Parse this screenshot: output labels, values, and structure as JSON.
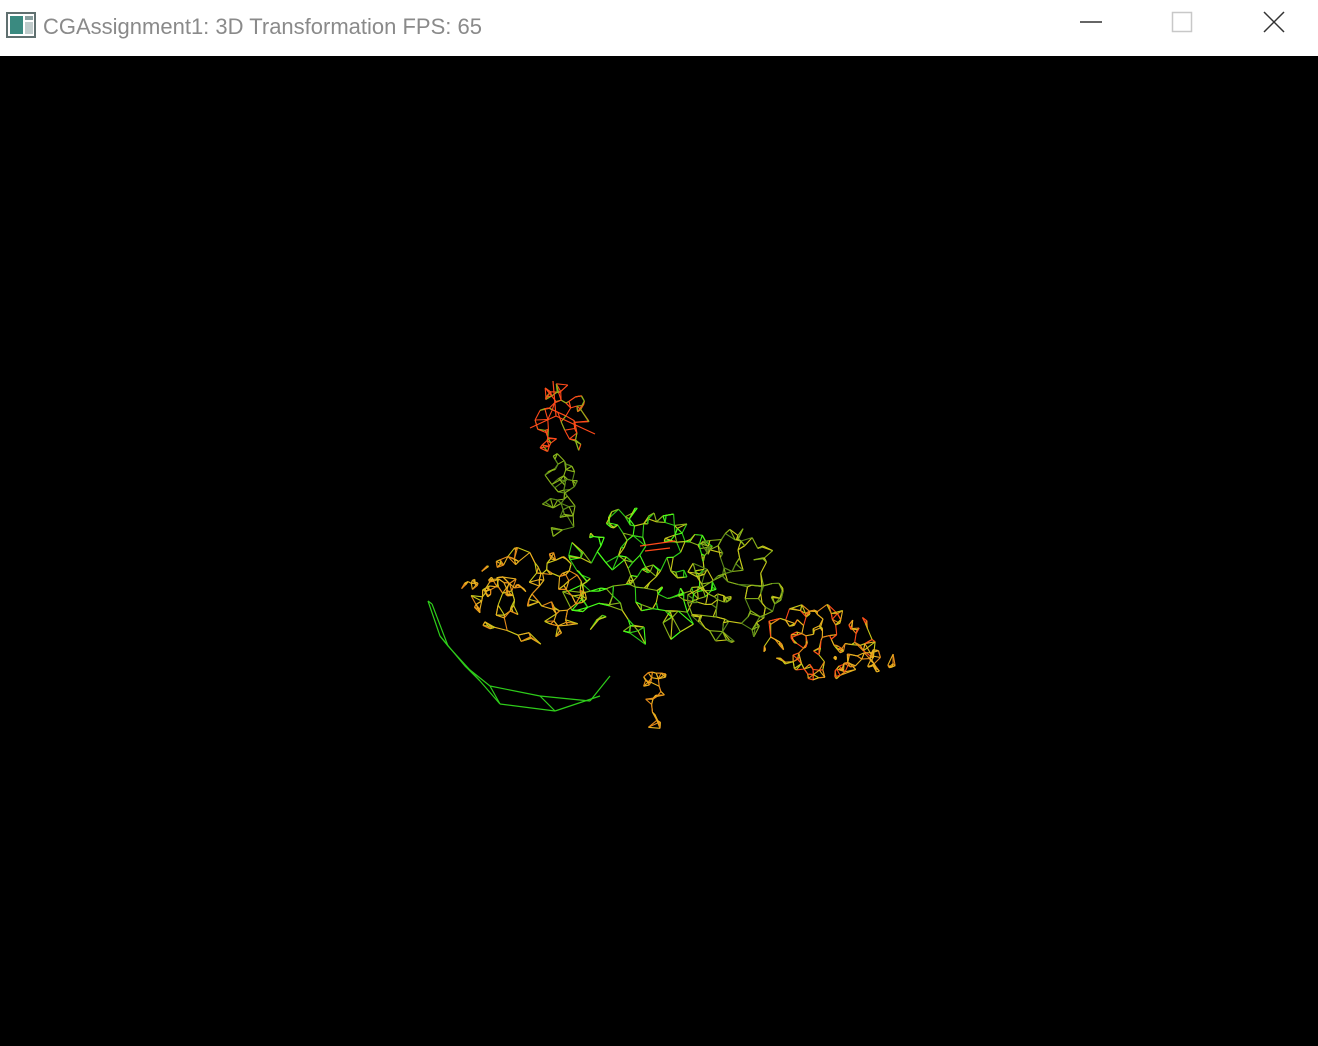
{
  "window": {
    "title": "CGAssignment1: 3D Transformation FPS: 65"
  },
  "titlebar_buttons": {
    "minimize_icon": "minimize-icon",
    "maximize_icon": "maximize-icon",
    "close_icon": "close-icon"
  },
  "viewport": {
    "background": "#000000",
    "palette": [
      "#ff4a1a",
      "#e8b020",
      "#c8c81a",
      "#8ab41a",
      "#2ecc1a",
      "#46ff1a",
      "#e68a1a",
      "#5a8a1a"
    ]
  }
}
